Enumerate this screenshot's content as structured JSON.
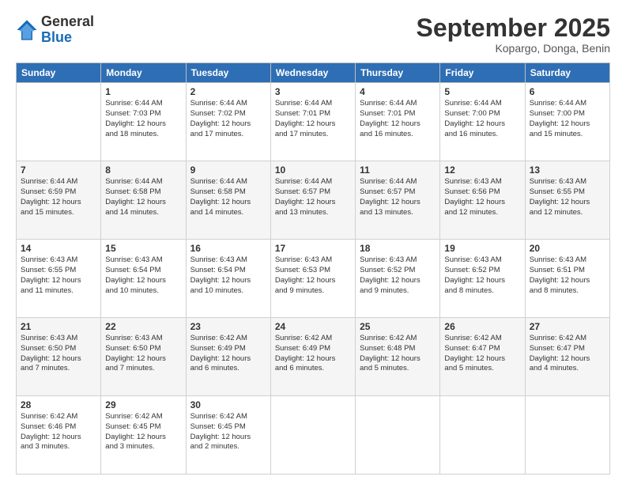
{
  "logo": {
    "general": "General",
    "blue": "Blue"
  },
  "header": {
    "month": "September 2025",
    "location": "Kopargo, Donga, Benin"
  },
  "days_of_week": [
    "Sunday",
    "Monday",
    "Tuesday",
    "Wednesday",
    "Thursday",
    "Friday",
    "Saturday"
  ],
  "weeks": [
    [
      {
        "day": "",
        "info": ""
      },
      {
        "day": "1",
        "info": "Sunrise: 6:44 AM\nSunset: 7:03 PM\nDaylight: 12 hours\nand 18 minutes."
      },
      {
        "day": "2",
        "info": "Sunrise: 6:44 AM\nSunset: 7:02 PM\nDaylight: 12 hours\nand 17 minutes."
      },
      {
        "day": "3",
        "info": "Sunrise: 6:44 AM\nSunset: 7:01 PM\nDaylight: 12 hours\nand 17 minutes."
      },
      {
        "day": "4",
        "info": "Sunrise: 6:44 AM\nSunset: 7:01 PM\nDaylight: 12 hours\nand 16 minutes."
      },
      {
        "day": "5",
        "info": "Sunrise: 6:44 AM\nSunset: 7:00 PM\nDaylight: 12 hours\nand 16 minutes."
      },
      {
        "day": "6",
        "info": "Sunrise: 6:44 AM\nSunset: 7:00 PM\nDaylight: 12 hours\nand 15 minutes."
      }
    ],
    [
      {
        "day": "7",
        "info": "Sunrise: 6:44 AM\nSunset: 6:59 PM\nDaylight: 12 hours\nand 15 minutes."
      },
      {
        "day": "8",
        "info": "Sunrise: 6:44 AM\nSunset: 6:58 PM\nDaylight: 12 hours\nand 14 minutes."
      },
      {
        "day": "9",
        "info": "Sunrise: 6:44 AM\nSunset: 6:58 PM\nDaylight: 12 hours\nand 14 minutes."
      },
      {
        "day": "10",
        "info": "Sunrise: 6:44 AM\nSunset: 6:57 PM\nDaylight: 12 hours\nand 13 minutes."
      },
      {
        "day": "11",
        "info": "Sunrise: 6:44 AM\nSunset: 6:57 PM\nDaylight: 12 hours\nand 13 minutes."
      },
      {
        "day": "12",
        "info": "Sunrise: 6:43 AM\nSunset: 6:56 PM\nDaylight: 12 hours\nand 12 minutes."
      },
      {
        "day": "13",
        "info": "Sunrise: 6:43 AM\nSunset: 6:55 PM\nDaylight: 12 hours\nand 12 minutes."
      }
    ],
    [
      {
        "day": "14",
        "info": "Sunrise: 6:43 AM\nSunset: 6:55 PM\nDaylight: 12 hours\nand 11 minutes."
      },
      {
        "day": "15",
        "info": "Sunrise: 6:43 AM\nSunset: 6:54 PM\nDaylight: 12 hours\nand 10 minutes."
      },
      {
        "day": "16",
        "info": "Sunrise: 6:43 AM\nSunset: 6:54 PM\nDaylight: 12 hours\nand 10 minutes."
      },
      {
        "day": "17",
        "info": "Sunrise: 6:43 AM\nSunset: 6:53 PM\nDaylight: 12 hours\nand 9 minutes."
      },
      {
        "day": "18",
        "info": "Sunrise: 6:43 AM\nSunset: 6:52 PM\nDaylight: 12 hours\nand 9 minutes."
      },
      {
        "day": "19",
        "info": "Sunrise: 6:43 AM\nSunset: 6:52 PM\nDaylight: 12 hours\nand 8 minutes."
      },
      {
        "day": "20",
        "info": "Sunrise: 6:43 AM\nSunset: 6:51 PM\nDaylight: 12 hours\nand 8 minutes."
      }
    ],
    [
      {
        "day": "21",
        "info": "Sunrise: 6:43 AM\nSunset: 6:50 PM\nDaylight: 12 hours\nand 7 minutes."
      },
      {
        "day": "22",
        "info": "Sunrise: 6:43 AM\nSunset: 6:50 PM\nDaylight: 12 hours\nand 7 minutes."
      },
      {
        "day": "23",
        "info": "Sunrise: 6:42 AM\nSunset: 6:49 PM\nDaylight: 12 hours\nand 6 minutes."
      },
      {
        "day": "24",
        "info": "Sunrise: 6:42 AM\nSunset: 6:49 PM\nDaylight: 12 hours\nand 6 minutes."
      },
      {
        "day": "25",
        "info": "Sunrise: 6:42 AM\nSunset: 6:48 PM\nDaylight: 12 hours\nand 5 minutes."
      },
      {
        "day": "26",
        "info": "Sunrise: 6:42 AM\nSunset: 6:47 PM\nDaylight: 12 hours\nand 5 minutes."
      },
      {
        "day": "27",
        "info": "Sunrise: 6:42 AM\nSunset: 6:47 PM\nDaylight: 12 hours\nand 4 minutes."
      }
    ],
    [
      {
        "day": "28",
        "info": "Sunrise: 6:42 AM\nSunset: 6:46 PM\nDaylight: 12 hours\nand 3 minutes."
      },
      {
        "day": "29",
        "info": "Sunrise: 6:42 AM\nSunset: 6:45 PM\nDaylight: 12 hours\nand 3 minutes."
      },
      {
        "day": "30",
        "info": "Sunrise: 6:42 AM\nSunset: 6:45 PM\nDaylight: 12 hours\nand 2 minutes."
      },
      {
        "day": "",
        "info": ""
      },
      {
        "day": "",
        "info": ""
      },
      {
        "day": "",
        "info": ""
      },
      {
        "day": "",
        "info": ""
      }
    ]
  ]
}
